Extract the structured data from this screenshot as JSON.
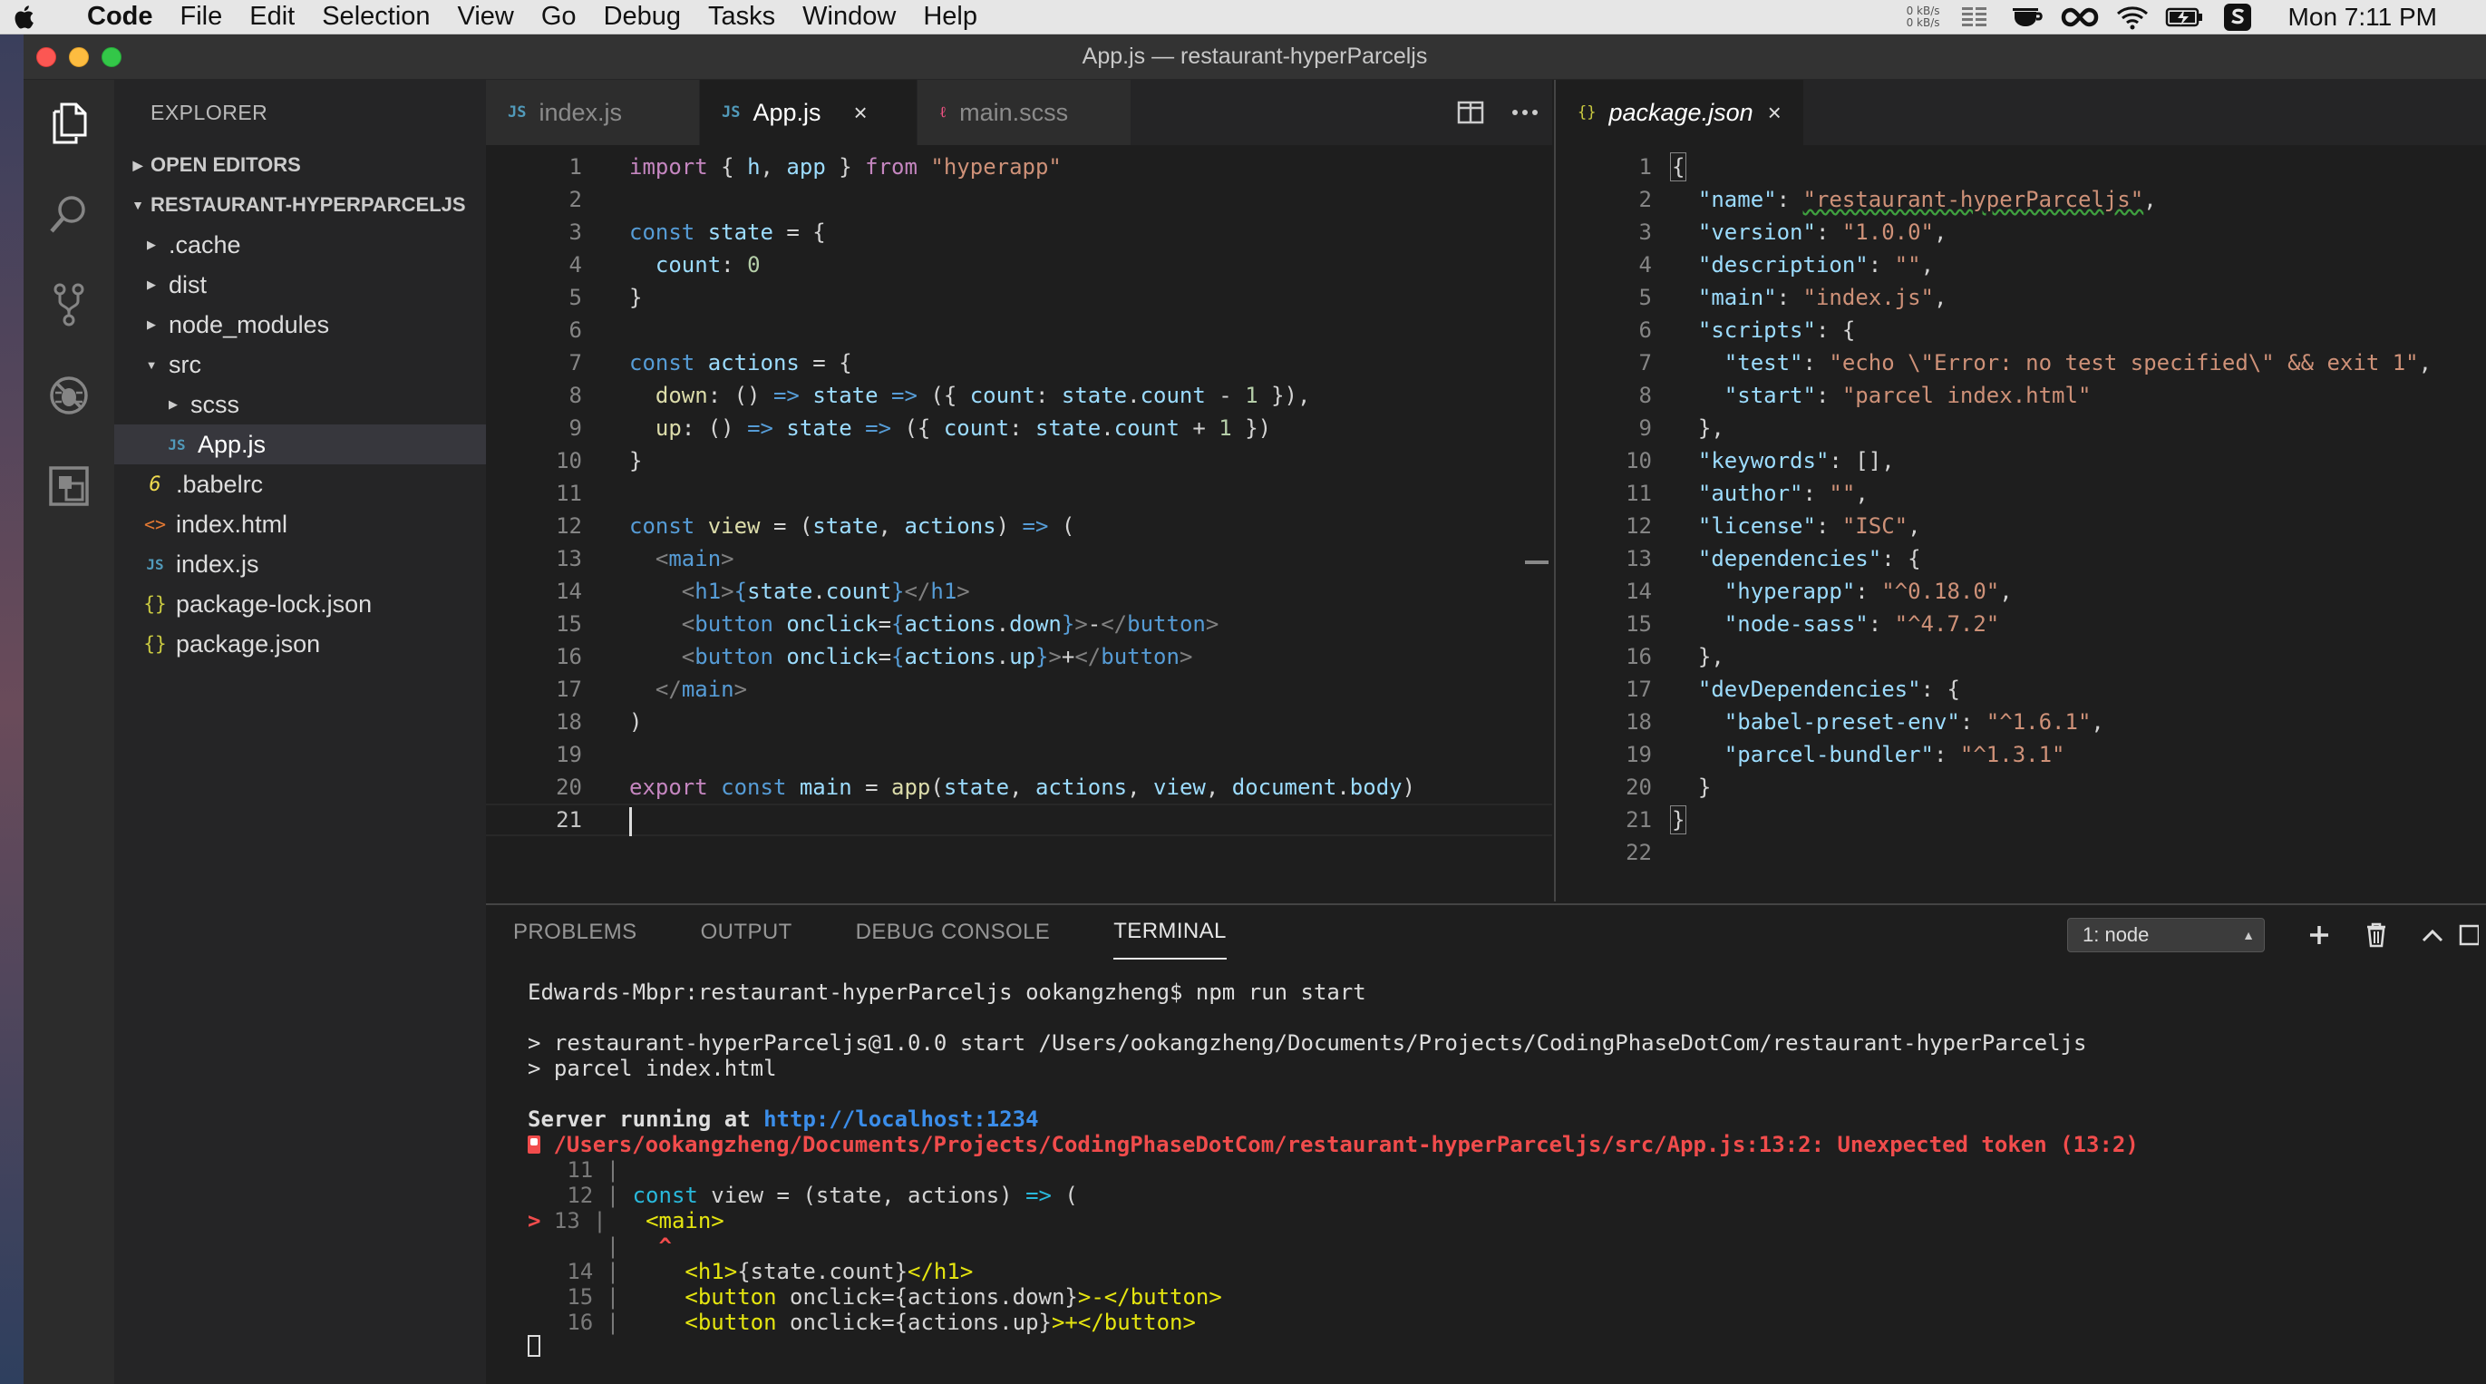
{
  "menubar": {
    "app": "Code",
    "items": [
      "File",
      "Edit",
      "Selection",
      "View",
      "Go",
      "Debug",
      "Tasks",
      "Window",
      "Help"
    ],
    "net_up": "0 kB/s",
    "net_down": "0 kB/s",
    "clock": "Mon 7:11 PM"
  },
  "window": {
    "title": "App.js — restaurant-hyperParceljs"
  },
  "explorer": {
    "header": "EXPLORER",
    "open_editors": "OPEN EDITORS",
    "project": "RESTAURANT-HYPERPARCELJS",
    "items": [
      {
        "label": ".cache"
      },
      {
        "label": "dist"
      },
      {
        "label": "node_modules"
      },
      {
        "label": "src"
      },
      {
        "label": "scss"
      },
      {
        "label": "App.js",
        "icon": "JS"
      },
      {
        "label": ".babelrc",
        "icon": "6"
      },
      {
        "label": "index.html",
        "icon": "<>"
      },
      {
        "label": "index.js",
        "icon": "JS"
      },
      {
        "label": "package-lock.json",
        "icon": "{}"
      },
      {
        "label": "package.json",
        "icon": "{}"
      }
    ]
  },
  "editor_left": {
    "tabs": [
      {
        "label": "index.js",
        "icon": "JS"
      },
      {
        "label": "App.js",
        "icon": "JS",
        "close": "×"
      },
      {
        "label": "main.scss",
        "icon": "ℓ"
      }
    ],
    "line_numbers": [
      "1",
      "2",
      "3",
      "4",
      "5",
      "6",
      "7",
      "8",
      "9",
      "10",
      "11",
      "12",
      "13",
      "14",
      "15",
      "16",
      "17",
      "18",
      "19",
      "20",
      "21"
    ]
  },
  "editor_right": {
    "tab": {
      "label": "package.json",
      "icon": "{}",
      "close": "×"
    },
    "line_numbers": [
      "1",
      "2",
      "3",
      "4",
      "5",
      "6",
      "7",
      "8",
      "9",
      "10",
      "11",
      "12",
      "13",
      "14",
      "15",
      "16",
      "17",
      "18",
      "19",
      "20",
      "21",
      "22"
    ]
  },
  "panel": {
    "tabs": [
      "PROBLEMS",
      "OUTPUT",
      "DEBUG CONSOLE",
      "TERMINAL"
    ],
    "terminal_select": "1: node",
    "terminal_lines": {
      "prompt": "Edwards-Mbpr:restaurant-hyperParceljs ookangzheng$ npm run start",
      "script1": "> restaurant-hyperParceljs@1.0.0 start /Users/ookangzheng/Documents/Projects/CodingPhaseDotCom/restaurant-hyperParceljs",
      "script2": "> parcel index.html",
      "server": "Server running at ",
      "url": "http://localhost:1234",
      "error": " /Users/ookangzheng/Documents/Projects/CodingPhaseDotCom/restaurant-hyperParceljs/src/App.js:13:2: Unexpected token (13:2)"
    }
  },
  "colors": {
    "keyword": "#569cd6",
    "string": "#ce9178",
    "function": "#dcdcaa",
    "variable": "#9cdcfe",
    "error": "#f14c4c",
    "link": "#3b8eea"
  }
}
